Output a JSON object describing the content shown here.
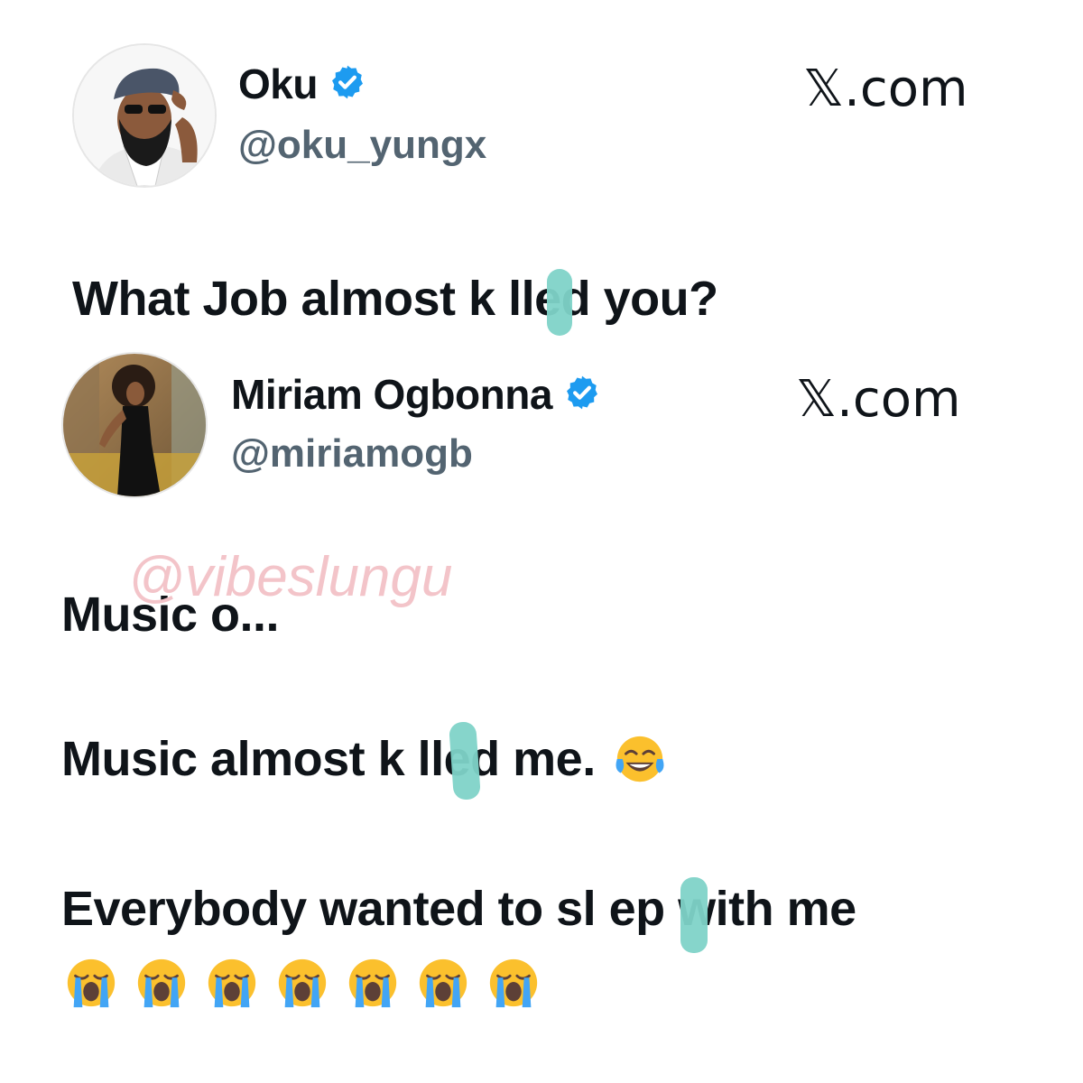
{
  "original_tweet": {
    "display_name": "Oku",
    "handle": "@oku_yungx",
    "brand": "𝕏.com",
    "text": "What Job almost k lled you?"
  },
  "reply_tweet": {
    "display_name": "Miriam Ogbonna",
    "handle": "@miriamogb",
    "brand": "𝕏.com",
    "lines": [
      "Music o...",
      "Music almost k lled me.",
      "Everybody wanted to sl ep with me"
    ],
    "emojis_line2": [
      "face-with-tears-of-joy"
    ],
    "emojis_line3": [
      "loudly-crying-face",
      "loudly-crying-face",
      "loudly-crying-face",
      "loudly-crying-face",
      "loudly-crying-face",
      "loudly-crying-face",
      "loudly-crying-face"
    ]
  },
  "watermark": "@vibeslungu",
  "colors": {
    "verified": "#1d9bf0",
    "handle": "#536471",
    "censor": "#7fd3c8",
    "watermark": "#f3c4c9"
  }
}
